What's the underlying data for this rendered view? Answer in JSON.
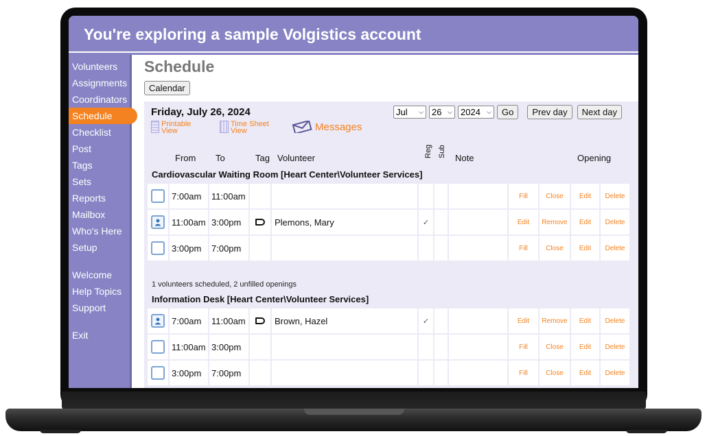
{
  "banner": {
    "text": "You're exploring a sample Volgistics account"
  },
  "sidebar": {
    "items": [
      {
        "label": "Volunteers"
      },
      {
        "label": "Assignments"
      },
      {
        "label": "Coordinators"
      },
      {
        "label": "Schedule",
        "active": true
      },
      {
        "label": "Checklist"
      },
      {
        "label": "Post"
      },
      {
        "label": "Tags"
      },
      {
        "label": "Sets"
      },
      {
        "label": "Reports"
      },
      {
        "label": "Mailbox"
      },
      {
        "label": "Who's Here"
      },
      {
        "label": "Setup"
      }
    ],
    "secondary": [
      {
        "label": "Welcome"
      },
      {
        "label": "Help Topics"
      },
      {
        "label": "Support"
      }
    ],
    "exit": {
      "label": "Exit"
    },
    "active_color": "#f58220",
    "bg_color": "#8783c4"
  },
  "page": {
    "title": "Schedule",
    "calendar_button": "Calendar",
    "date_title": "Friday, July 26, 2024",
    "printable_view": [
      "Printable",
      "View"
    ],
    "timesheet_view": [
      "Time Sheet",
      "View"
    ],
    "messages": "Messages",
    "month_select": "Jul",
    "day_select": "26",
    "year_select": "2024",
    "go_button": "Go",
    "prev_day_button": "Prev day",
    "next_day_button": "Next day"
  },
  "table": {
    "headers": {
      "from": "From",
      "to": "To",
      "tag": "Tag",
      "volunteer": "Volunteer",
      "reg": "Reg",
      "sub": "Sub",
      "note": "Note",
      "opening": "Opening"
    },
    "groups": [
      {
        "title": "Cardiovascular Waiting Room [Heart Center\\Volunteer Services]",
        "summary": "1 volunteers scheduled, 2 unfilled openings",
        "rows": [
          {
            "filled": false,
            "from": "7:00am",
            "to": "11:00am",
            "tag": false,
            "volunteer": "",
            "reg": "",
            "actions": [
              "Fill",
              "Close",
              "Edit",
              "Delete"
            ]
          },
          {
            "filled": true,
            "from": "11:00am",
            "to": "3:00pm",
            "tag": true,
            "volunteer": "Plemons, Mary",
            "reg": "✓",
            "actions": [
              "Edit",
              "Remove",
              "Edit",
              "Delete"
            ]
          },
          {
            "filled": false,
            "from": "3:00pm",
            "to": "7:00pm",
            "tag": false,
            "volunteer": "",
            "reg": "",
            "actions": [
              "Fill",
              "Close",
              "Edit",
              "Delete"
            ]
          }
        ]
      },
      {
        "title": "Information Desk [Heart Center\\Volunteer Services]",
        "rows": [
          {
            "filled": true,
            "from": "7:00am",
            "to": "11:00am",
            "tag": true,
            "volunteer": "Brown, Hazel",
            "reg": "✓",
            "actions": [
              "Edit",
              "Remove",
              "Edit",
              "Delete"
            ]
          },
          {
            "filled": false,
            "from": "11:00am",
            "to": "3:00pm",
            "tag": false,
            "volunteer": "",
            "reg": "",
            "actions": [
              "Fill",
              "Close",
              "Edit",
              "Delete"
            ]
          },
          {
            "filled": false,
            "from": "3:00pm",
            "to": "7:00pm",
            "tag": false,
            "volunteer": "",
            "reg": "",
            "actions": [
              "Fill",
              "Close",
              "Edit",
              "Delete"
            ]
          }
        ]
      }
    ]
  }
}
